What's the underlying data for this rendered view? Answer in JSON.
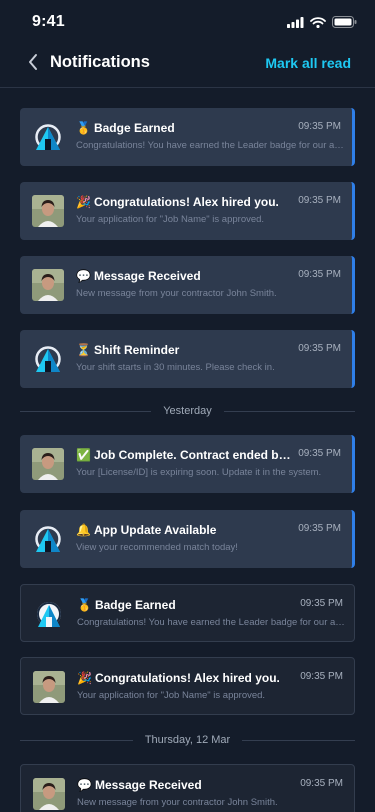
{
  "status_bar": {
    "time": "9:41"
  },
  "header": {
    "title": "Notifications",
    "mark_all_read": "Mark all read"
  },
  "items": [
    {
      "type": "card",
      "state": "unread",
      "avatar": "app-logo-icon",
      "emoji": "🥇",
      "title": "Badge Earned",
      "time": "09:35 PM",
      "message": "Congratulations! You have earned the Leader badge for our app."
    },
    {
      "type": "card",
      "state": "unread",
      "avatar": "user-photo",
      "emoji": "🎉",
      "title": "Congratulations! Alex hired you.",
      "time": "09:35 PM",
      "message": "Your application for \"Job Name\" is approved."
    },
    {
      "type": "card",
      "state": "unread",
      "avatar": "user-photo",
      "emoji": "💬",
      "title": "Message Received",
      "time": "09:35 PM",
      "message": "New message from your contractor  John Smith."
    },
    {
      "type": "card",
      "state": "unread",
      "avatar": "app-logo-icon",
      "emoji": "⏳",
      "title": "Shift Reminder",
      "time": "09:35 PM",
      "message": "Your shift starts in 30 minutes. Please check in."
    },
    {
      "type": "divider",
      "label": "Yesterday"
    },
    {
      "type": "card",
      "state": "unread",
      "avatar": "user-photo",
      "emoji": "✅",
      "title": "Job Complete. Contract ended by client.",
      "time": "09:35 PM",
      "message": "Your [License/ID] is expiring soon. Update it in the system."
    },
    {
      "type": "card",
      "state": "unread",
      "avatar": "app-logo-icon",
      "emoji": "🔔",
      "title": "App Update Available",
      "time": "09:35 PM",
      "message": "View your recommended match today!"
    },
    {
      "type": "card",
      "state": "read",
      "avatar": "app-logo-icon-light",
      "emoji": "🥇",
      "title": "Badge Earned",
      "time": "09:35 PM",
      "message": "Congratulations! You have earned the Leader badge for our app."
    },
    {
      "type": "card",
      "state": "read",
      "avatar": "user-photo",
      "emoji": "🎉",
      "title": "Congratulations! Alex hired you.",
      "time": "09:35 PM",
      "message": "Your application for \"Job Name\" is approved."
    },
    {
      "type": "divider",
      "label": "Thursday, 12 Mar"
    },
    {
      "type": "card",
      "state": "read",
      "avatar": "user-photo",
      "emoji": "💬",
      "title": "Message Received",
      "time": "09:35 PM",
      "message": "New message from your contractor  John Smith."
    }
  ],
  "colors": {
    "background": "#141c2a",
    "card_unread": "#2e3a4e",
    "card_read": "#1d2533",
    "accent": "#1ec8f2",
    "unread_marker": "#2f7fe8"
  }
}
